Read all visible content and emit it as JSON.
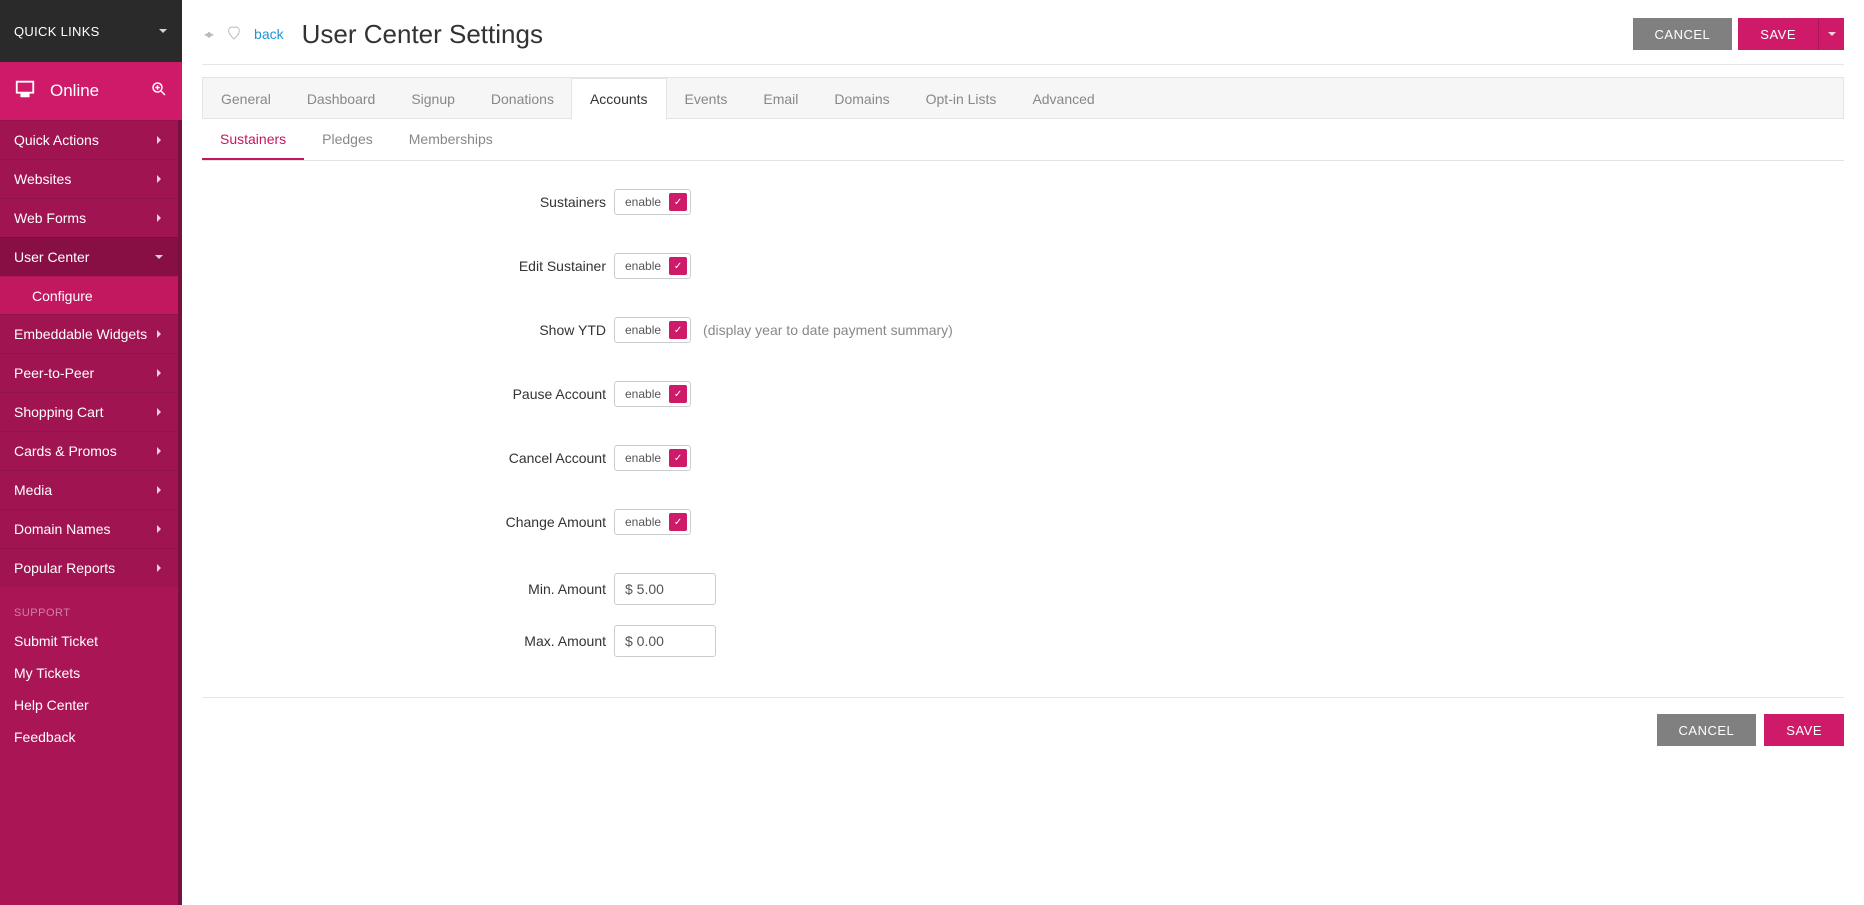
{
  "sidebar": {
    "quick_links_label": "QUICK LINKS",
    "brand": "Online",
    "nav": [
      {
        "label": "Quick Actions",
        "expandable": true
      },
      {
        "label": "Websites",
        "expandable": true
      },
      {
        "label": "Web Forms",
        "expandable": true
      },
      {
        "label": "User Center",
        "expandable": true,
        "expanded": true,
        "children": [
          {
            "label": "Configure"
          }
        ]
      },
      {
        "label": "Embeddable Widgets",
        "expandable": true
      },
      {
        "label": "Peer-to-Peer",
        "expandable": true
      },
      {
        "label": "Shopping Cart",
        "expandable": true
      },
      {
        "label": "Cards & Promos",
        "expandable": true
      },
      {
        "label": "Media",
        "expandable": true
      },
      {
        "label": "Domain Names",
        "expandable": true
      },
      {
        "label": "Popular Reports",
        "expandable": true
      }
    ],
    "support_heading": "SUPPORT",
    "support": [
      {
        "label": "Submit Ticket"
      },
      {
        "label": "My Tickets"
      },
      {
        "label": "Help Center"
      },
      {
        "label": "Feedback"
      }
    ]
  },
  "header": {
    "back_label": "back",
    "title": "User Center Settings",
    "cancel_label": "CANCEL",
    "save_label": "SAVE"
  },
  "tabs": {
    "items": [
      {
        "label": "General"
      },
      {
        "label": "Dashboard"
      },
      {
        "label": "Signup"
      },
      {
        "label": "Donations"
      },
      {
        "label": "Accounts",
        "active": true
      },
      {
        "label": "Events"
      },
      {
        "label": "Email"
      },
      {
        "label": "Domains"
      },
      {
        "label": "Opt-in Lists"
      },
      {
        "label": "Advanced"
      }
    ]
  },
  "subtabs": {
    "items": [
      {
        "label": "Sustainers",
        "active": true
      },
      {
        "label": "Pledges"
      },
      {
        "label": "Memberships"
      }
    ]
  },
  "form": {
    "enable_label": "enable",
    "rows": [
      {
        "label": "Sustainers",
        "type": "toggle"
      },
      {
        "label": "Edit Sustainer",
        "type": "toggle"
      },
      {
        "label": "Show YTD",
        "type": "toggle",
        "help": "(display year to date payment summary)"
      },
      {
        "label": "Pause Account",
        "type": "toggle"
      },
      {
        "label": "Cancel Account",
        "type": "toggle"
      },
      {
        "label": "Change Amount",
        "type": "toggle"
      }
    ],
    "min_amount_label": "Min. Amount",
    "min_amount_value": "$ 5.00",
    "max_amount_label": "Max. Amount",
    "max_amount_value": "$ 0.00"
  },
  "footer": {
    "cancel_label": "CANCEL",
    "save_label": "SAVE"
  }
}
